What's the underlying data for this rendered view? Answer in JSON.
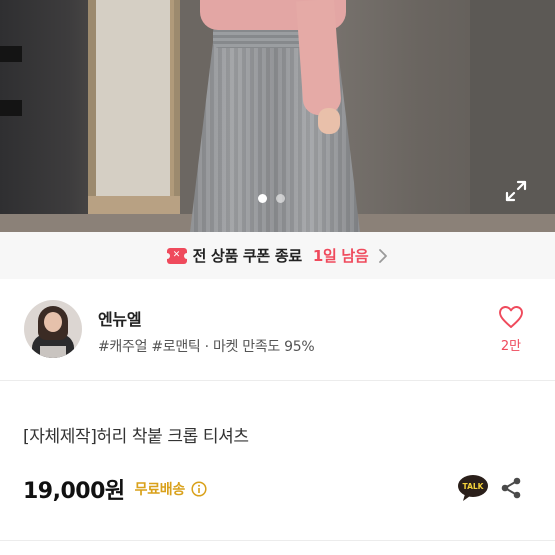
{
  "gallery": {
    "dot_count": 2,
    "active_dot": 1
  },
  "coupon_banner": {
    "text": "전 상품 쿠폰 종료",
    "highlight": "1일 남음",
    "icon_text": "✕",
    "highlight_color": "#ef4a5c"
  },
  "seller": {
    "name": "엔뉴엘",
    "tags": "#캐주얼 #로맨틱 · 마켓 만족도 95%",
    "like_count": "2만"
  },
  "product": {
    "title": "[자체제작]허리 착붙 크롭 티셔츠",
    "price": "19,000원",
    "shipping": "무료배송",
    "shipping_color": "#d9a11b"
  },
  "actions": {
    "talk_label": "TALK"
  },
  "icons": {
    "expand": "expand-icon",
    "coupon": "coupon-icon",
    "chevron": "chevron-right-icon",
    "heart": "heart-icon",
    "info": "info-icon",
    "talk": "kakaotalk-icon",
    "share": "share-icon"
  }
}
